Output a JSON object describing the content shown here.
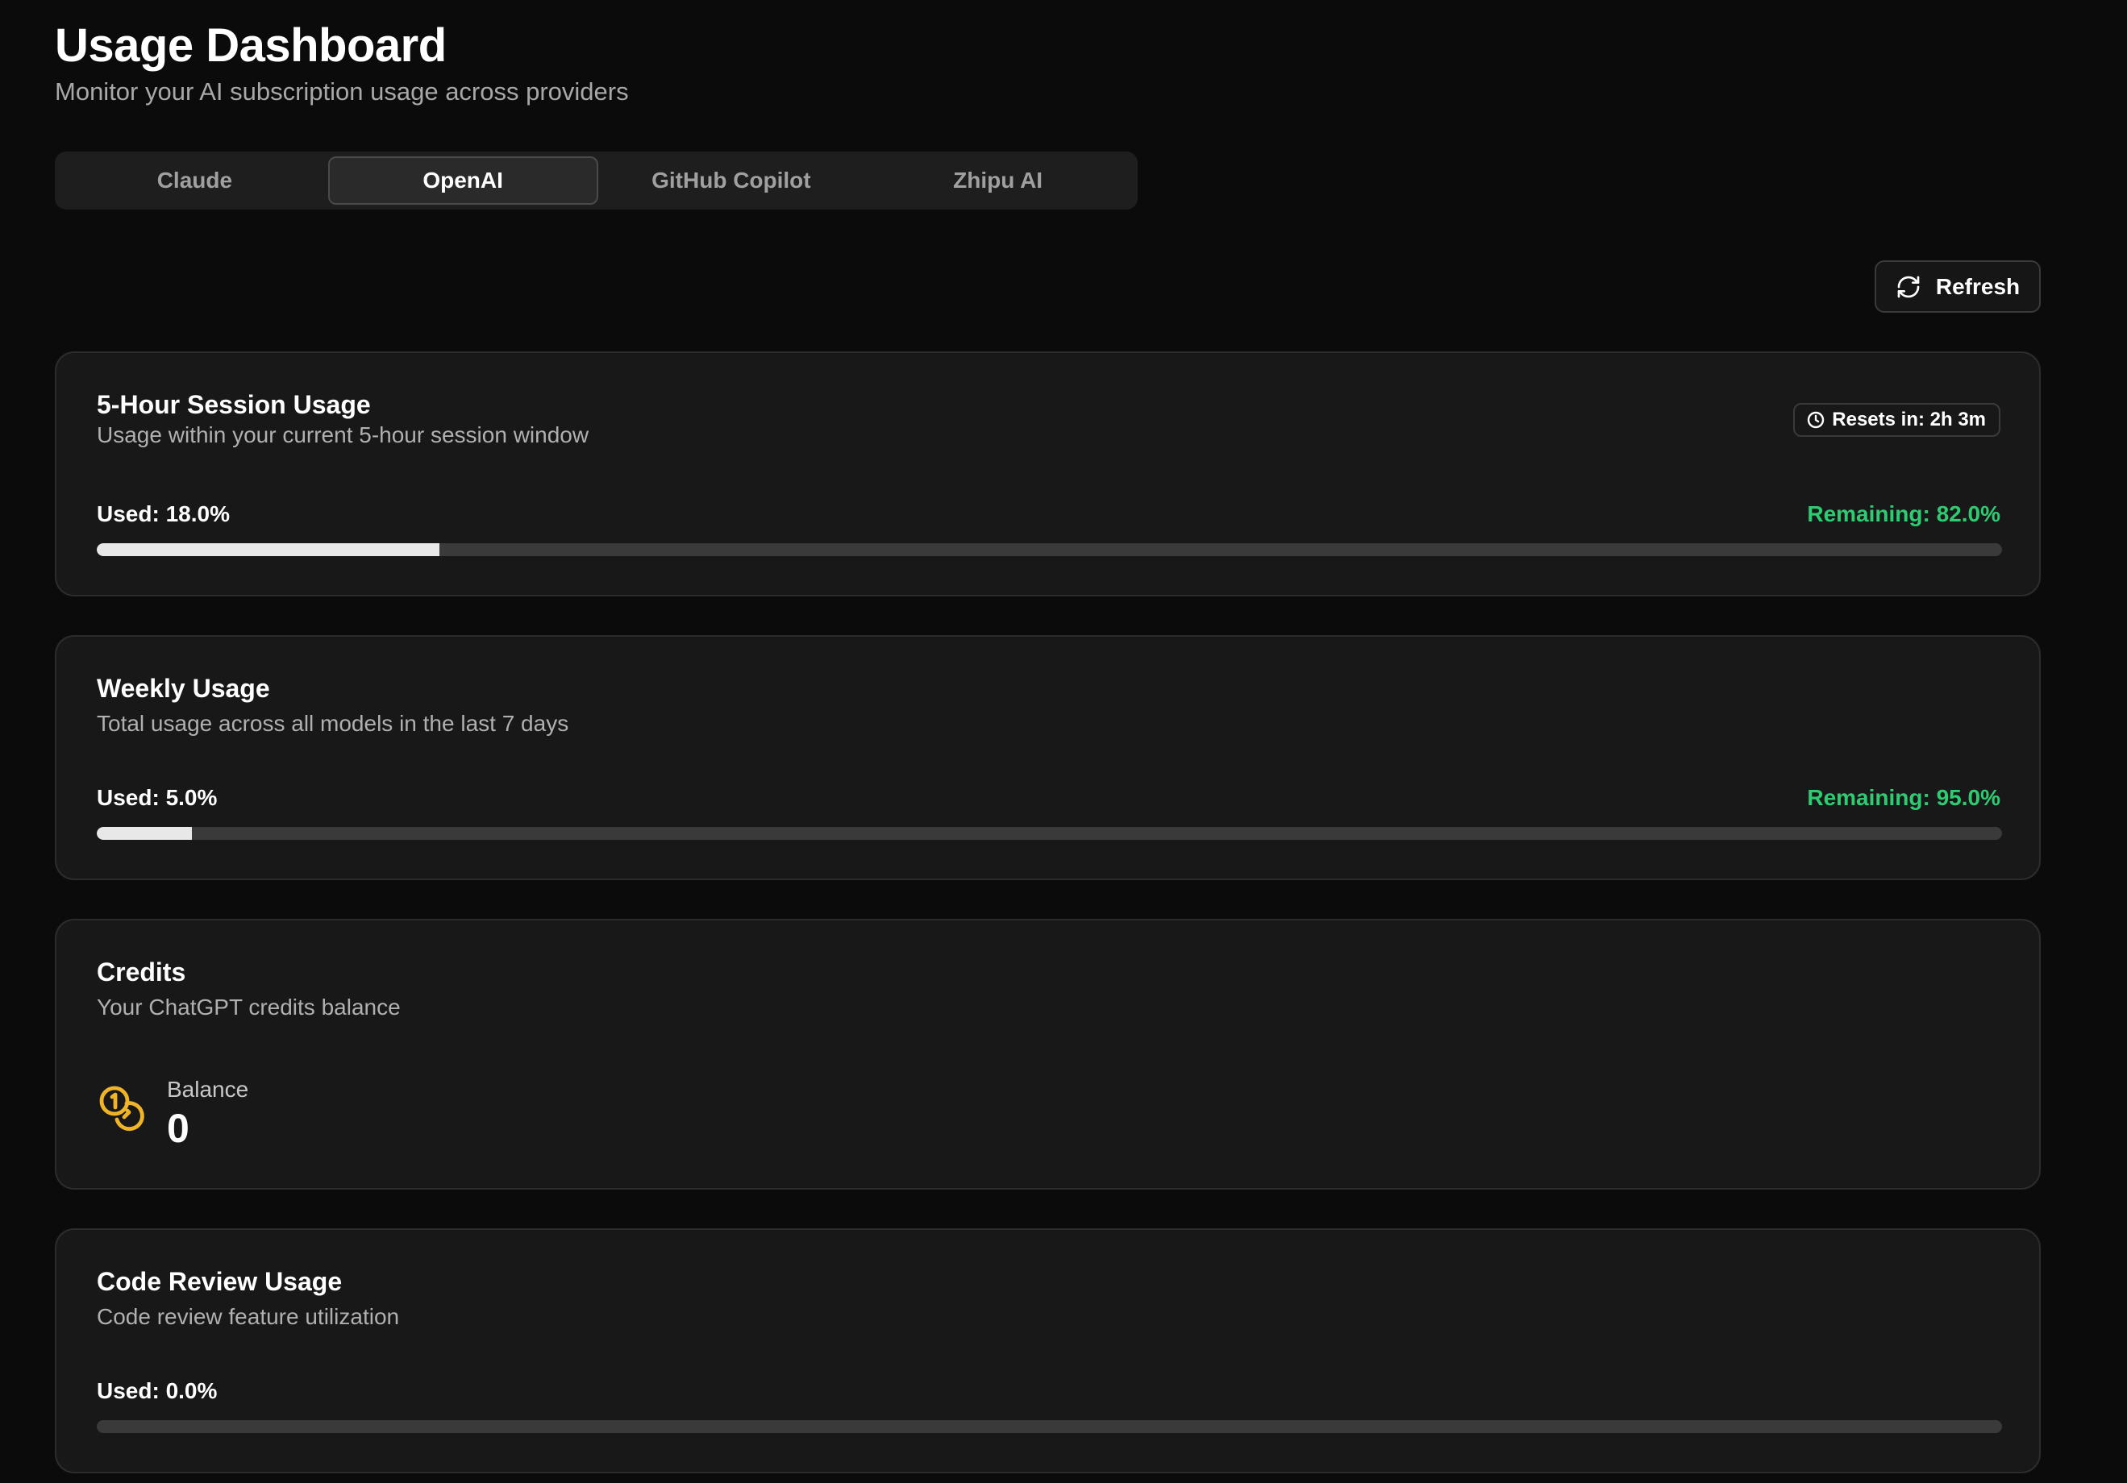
{
  "header": {
    "title": "Usage Dashboard",
    "subtitle": "Monitor your AI subscription usage across providers"
  },
  "tabs": [
    {
      "label": "Claude",
      "active": false
    },
    {
      "label": "OpenAI",
      "active": true
    },
    {
      "label": "GitHub Copilot",
      "active": false
    },
    {
      "label": "Zhipu AI",
      "active": false
    }
  ],
  "toolbar": {
    "refresh_label": "Refresh",
    "refresh_icon": "refresh-icon"
  },
  "session": {
    "title": "5-Hour Session Usage",
    "description": "Usage within your current 5-hour session window",
    "reset_label": "Resets in: 2h 3m",
    "reset_icon": "clock-icon",
    "used_label": "Used: 18.0%",
    "remaining_label": "Remaining: 82.0%",
    "used_fraction": 0.18
  },
  "weekly": {
    "title": "Weekly Usage",
    "description": "Total usage across all models in the last 7 days",
    "used_label": "Used: 5.0%",
    "remaining_label": "Remaining: 95.0%",
    "used_fraction": 0.05
  },
  "credits": {
    "title": "Credits",
    "description": "Your ChatGPT credits balance",
    "balance_label": "Balance",
    "balance_value": "0",
    "icon": "coins-icon",
    "icon_color": "#f0b429"
  },
  "code_review": {
    "title": "Code Review Usage",
    "description": "Code review feature utilization",
    "used_label": "Used: 0.0%",
    "used_fraction": 0.0
  },
  "colors": {
    "background": "#0b0b0b",
    "card": "#181818",
    "remaining_green": "#2ecc71",
    "progress_fill": "#e8e8e8",
    "progress_track": "#3a3a3a"
  }
}
